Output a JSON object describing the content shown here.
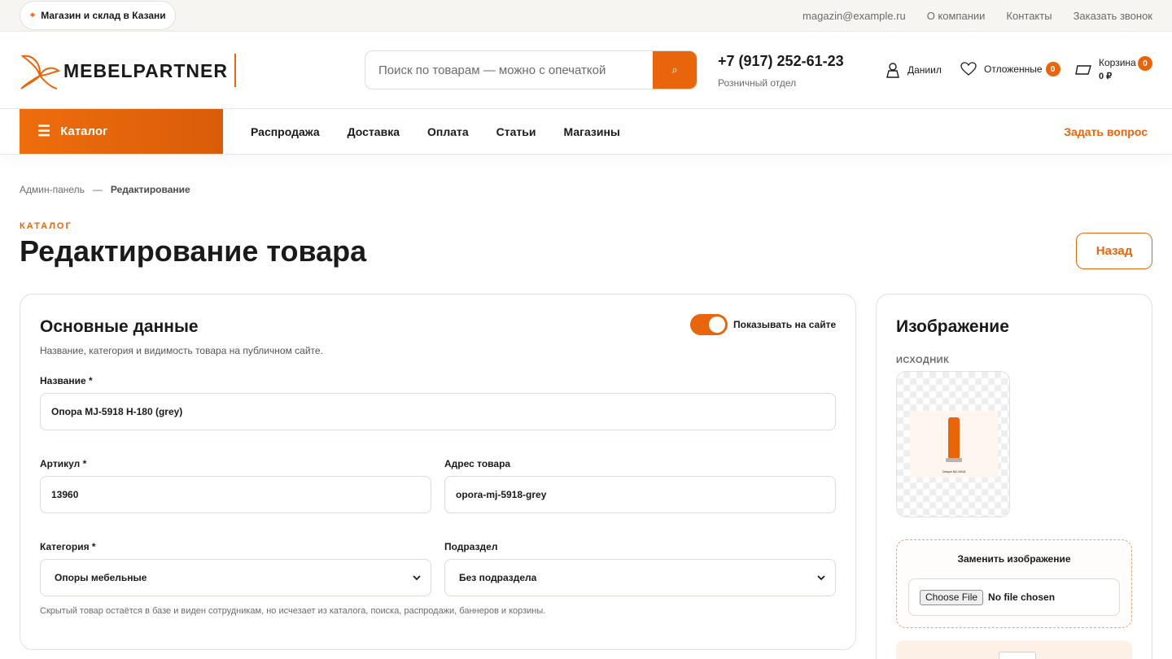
{
  "topbar": {
    "store": "Магазин и склад в Казани",
    "links": [
      "magazin@example.ru",
      "О компании",
      "Контакты",
      "Заказать звонок"
    ]
  },
  "header": {
    "logo_text": "MEBELPARTNER",
    "search_placeholder": "Поиск по товарам — можно с опечаткой",
    "phone": "+7 (917) 252-61-23",
    "phone_sub": "Розничный отдел",
    "user_name": "Даниил",
    "favorites_label": "Отложенные",
    "favorites_count": "0",
    "cart_label": "Корзина",
    "cart_sum": "0 ₽",
    "cart_count": "0"
  },
  "nav": {
    "catalog": "Каталог",
    "links": [
      "Распродажа",
      "Доставка",
      "Оплата",
      "Статьи",
      "Магазины"
    ],
    "ask": "Задать вопрос"
  },
  "breadcrumb": {
    "parent": "Админ-панель",
    "separator": "—",
    "current": "Редактирование"
  },
  "page": {
    "eyebrow": "КАТАЛОГ",
    "title": "Редактирование товара",
    "back": "Назад"
  },
  "main_card": {
    "title": "Основные данные",
    "subtitle": "Название, категория и видимость товара на публичном сайте.",
    "toggle_label": "Показывать на сайте",
    "toggle_on": true,
    "name_label": "Название *",
    "name_value": "Опора MJ-5918 H-180 (grey)",
    "sku_label": "Артикул *",
    "sku_value": "13960",
    "slug_label": "Адрес товара",
    "slug_value": "opora-mj-5918-grey",
    "category_label": "Категория *",
    "category_value": "Опоры мебельные",
    "subcategory_label": "Подраздел",
    "subcategory_value": "Без подраздела",
    "hint": "Скрытый товар остаётся в базе и виден сотрудникам, но исчезает из каталога, поиска, распродажи, баннеров и корзины."
  },
  "image_card": {
    "title": "Изображение",
    "source_label": "ИСХОДНИК",
    "thumb_caption": "Опора MJ-5918",
    "replace_title": "Заменить изображение",
    "choose_file": "Choose File",
    "no_file": "No file chosen"
  },
  "colors": {
    "accent": "#e8650c",
    "text": "#1a1a1a",
    "muted": "#6b6b6b",
    "border": "#e4e0db"
  }
}
